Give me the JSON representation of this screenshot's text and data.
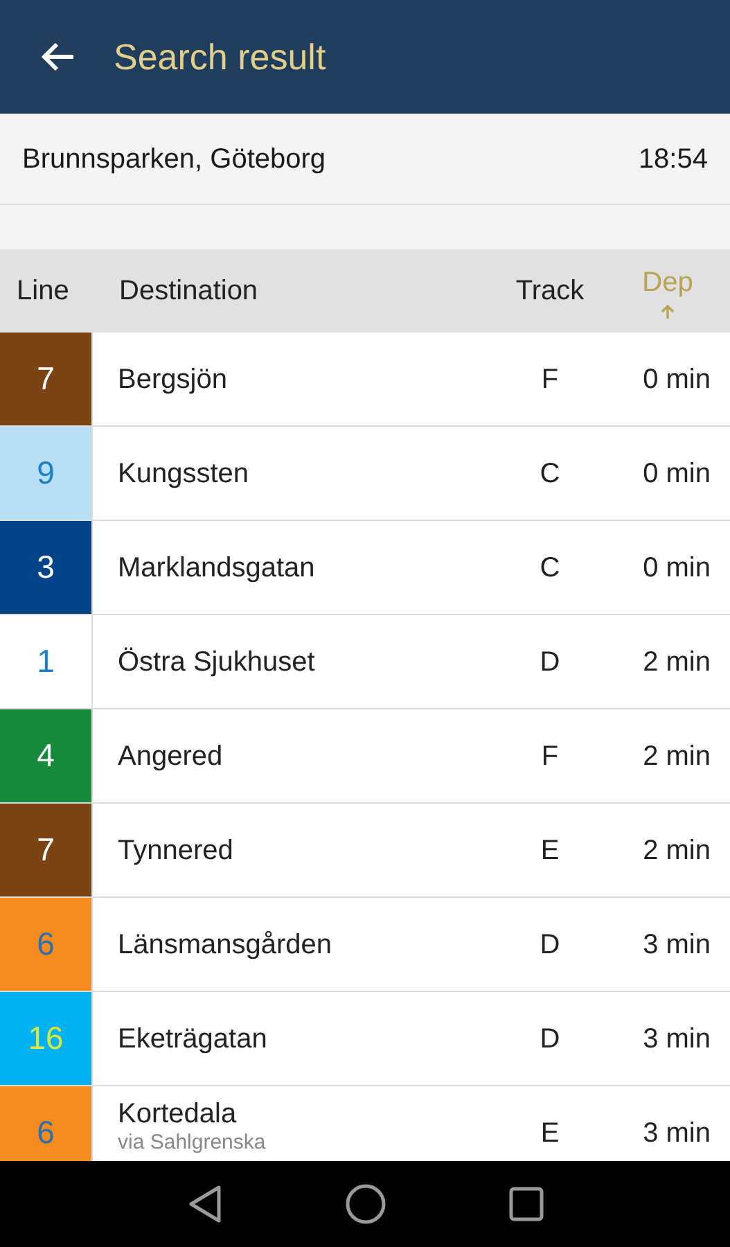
{
  "app_bar": {
    "title": "Search result"
  },
  "stop": {
    "name": "Brunnsparken, Göteborg",
    "time": "18:54"
  },
  "columns": [
    {
      "label": "Line",
      "sorted": false
    },
    {
      "label": "Destination",
      "sorted": false
    },
    {
      "label": "Track",
      "sorted": false
    },
    {
      "label": "Dep",
      "sorted": true
    }
  ],
  "rows": [
    {
      "color": "#7a4414",
      "line": {
        "text": "7",
        "color": "#ffffff"
      },
      "destination": "Bergsjön",
      "track": "F",
      "departure": "0 min"
    },
    {
      "color": "#b7e0f7",
      "line": {
        "text": "9",
        "color": "#1e7fc4"
      },
      "destination": "Kungssten",
      "track": "C",
      "departure": "0 min"
    },
    {
      "color": "#004487",
      "line": {
        "text": "3",
        "color": "#ffffff"
      },
      "destination": "Marklandsgatan",
      "track": "C",
      "departure": "0 min"
    },
    {
      "color": "#ffffff",
      "line": {
        "text": "1",
        "color": "#1e7fc4"
      },
      "destination": "Östra Sjukhuset",
      "track": "D",
      "departure": "2 min"
    },
    {
      "color": "#178a3c",
      "line": {
        "text": "4",
        "color": "#ffffff"
      },
      "destination": "Angered",
      "track": "F",
      "departure": "2 min"
    },
    {
      "color": "#7a4414",
      "line": {
        "text": "7",
        "color": "#ffffff"
      },
      "destination": "Tynnered",
      "track": "E",
      "departure": "2 min"
    },
    {
      "color": "#f68b1f",
      "line": {
        "text": "6",
        "color": "#2d6fa8"
      },
      "destination": "Länsmansgården",
      "track": "D",
      "departure": "3 min"
    },
    {
      "color": "#00b2ef",
      "line": {
        "text": "16",
        "color": "#d6e84a"
      },
      "destination": "Eketrägatan",
      "track": "D",
      "departure": "3 min"
    },
    {
      "color": "#f68b1f",
      "line": {
        "text": "6",
        "color": "#2d6fa8"
      },
      "destination": "Kortedala",
      "via": "via Sahlgrenska",
      "track": "E",
      "departure": "3 min"
    }
  ]
}
